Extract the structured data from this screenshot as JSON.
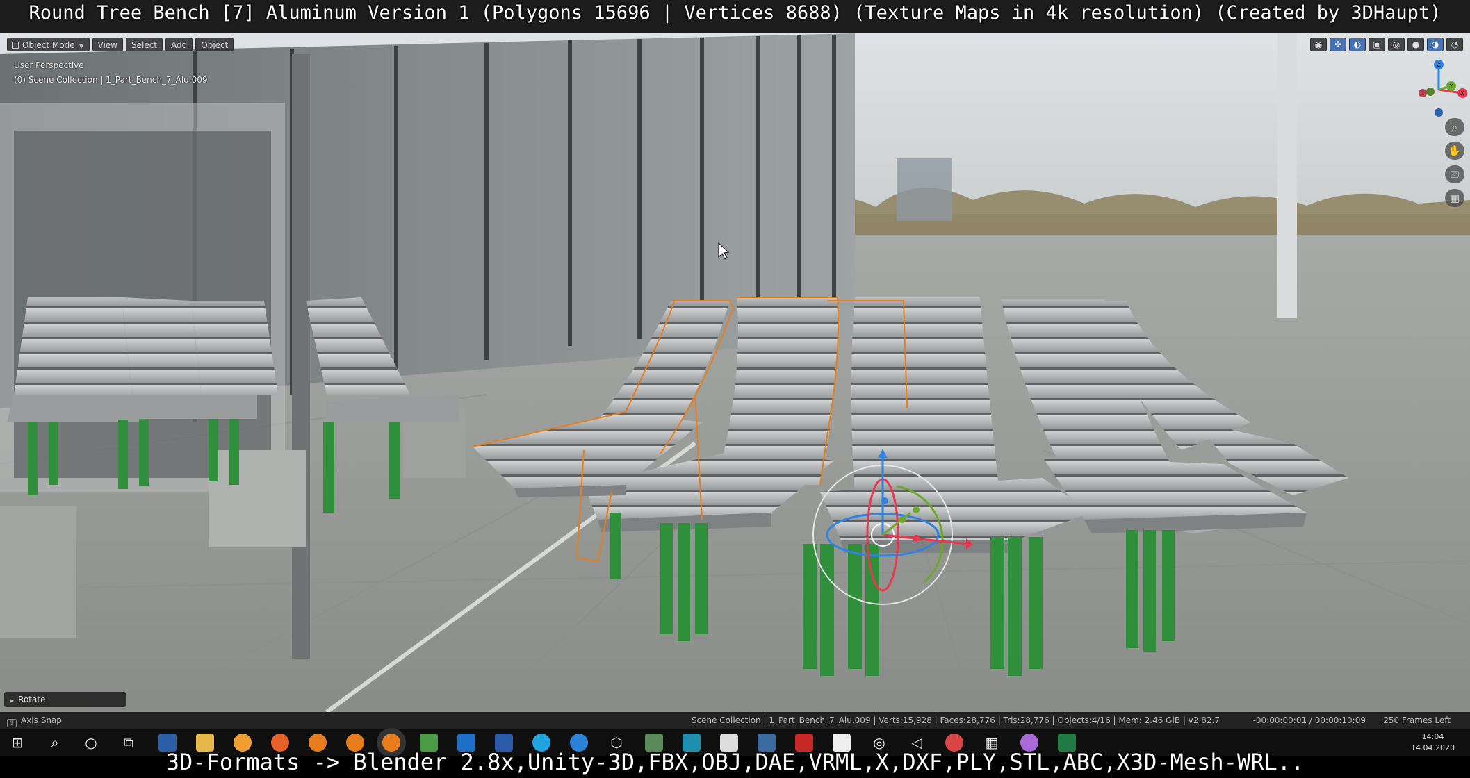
{
  "captions": {
    "top": "Round Tree Bench [7] Aluminum Version 1 (Polygons 15696 | Vertices 8688) (Texture Maps in 4k resolution) (Created by 3DHaupt)",
    "bottom": "3D-Formats -> Blender 2.8x,Unity-3D,FBX,OBJ,DAE,VRML,X,DXF,PLY,STL,ABC,X3D-Mesh-WRL.."
  },
  "viewport_header": {
    "mode": "Object Mode",
    "menus": [
      "View",
      "Select",
      "Add",
      "Object"
    ]
  },
  "view_info": {
    "perspective": "User Perspective",
    "collection": "(0) Scene Collection | 1_Part_Bench_7_Alu.009"
  },
  "gizmo": {
    "axis_x": "X",
    "axis_y": "Y",
    "axis_z": "Z",
    "colors": {
      "x": "#e8384f",
      "y": "#6ea82b",
      "z": "#2f83e3"
    }
  },
  "last_operator": "Rotate",
  "status_bar": {
    "left": "Axis Snap",
    "stats": "Scene Collection | 1_Part_Bench_7_Alu.009 | Verts:15,928 | Faces:28,776 | Tris:28,776 | Objects:4/16 | Mem: 2.46 GiB | v2.82.7",
    "time": "-00:00:00:01 / 00:00:10:09",
    "frames": "250 Frames Left"
  },
  "taskbar": {
    "apps": [
      "start",
      "search",
      "cortana",
      "task-view",
      "save",
      "explorer",
      "app-orange",
      "firefox",
      "blender-1",
      "blender-2",
      "blender-3",
      "image-editor",
      "outlook",
      "word",
      "skype",
      "edge",
      "3d-viewer",
      "app-green",
      "vectornator",
      "app-triangle",
      "app-ship",
      "acrobat",
      "unity",
      "app-circle",
      "unity-2",
      "app-red",
      "calculator",
      "maps",
      "excel"
    ],
    "time": "14:04",
    "date": "14.04.2020"
  },
  "colors": {
    "accent": "#4772b3",
    "selection_outline": "#e87d1e",
    "bench_leg_green": "#2f8f3a"
  }
}
